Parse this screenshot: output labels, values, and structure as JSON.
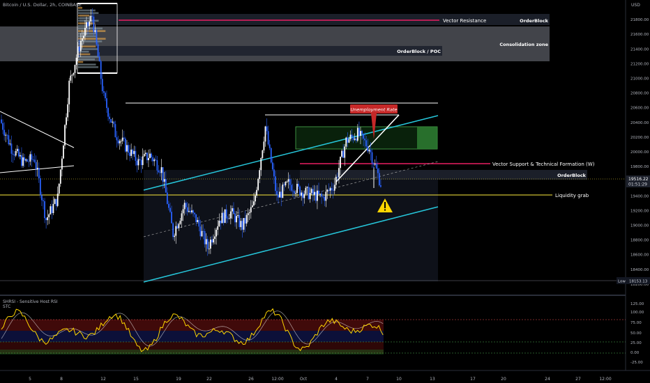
{
  "header": {
    "symbol_title": "Bitcoin / U.S. Dollar, 2h, COINBASE"
  },
  "price_axis": {
    "unit": "USD",
    "ticks": [
      "21800.00",
      "21600.00",
      "21400.00",
      "21200.00",
      "21000.00",
      "20800.00",
      "20600.00",
      "20400.00",
      "20200.00",
      "20000.00",
      "19800.00",
      "19600.00",
      "19400.00",
      "19200.00",
      "19000.00",
      "18800.00",
      "18600.00",
      "18400.00",
      "18200.00"
    ],
    "current_price": "19516.22",
    "countdown": "01:51:29",
    "low_label": "Low",
    "low_value": "18153.13"
  },
  "time_axis": {
    "ticks": [
      "5",
      "8",
      "12",
      "15",
      "19",
      "22",
      "26",
      "12:00",
      "Oct",
      "4",
      "7",
      "10",
      "13",
      "17",
      "20",
      "24",
      "27",
      "12:00"
    ]
  },
  "indicators": {
    "shrsi_title": "SHRSI - Sensitive Host RSI",
    "stc_title": "STC",
    "ticks": [
      "125.00",
      "100.00",
      "75.00",
      "50.00",
      "25.00",
      "0.00",
      "-25.00"
    ]
  },
  "annotations": {
    "vector_resistance": "Vector Resistance",
    "orderblock_top": "OrderBlock",
    "consolidation_zone": "Consolidation zone",
    "orderblock_poc": "OrderBlock / POC",
    "unemployment_rate": "Unemployment Rate",
    "vector_support": "Vector Support & Technical Formation (W)",
    "orderblock_mid": "OrderBlock",
    "liquidity_grab": "Liquidity grab",
    "warning_icon": "warning-triangle-icon"
  },
  "colors": {
    "background": "#000000",
    "candle_up": "#ffffff",
    "candle_down": "#2962ff",
    "channel": "#26c6da",
    "vector_line": "#e91e63",
    "liquidity_line": "#ffeb3b",
    "stc_line": "#ffd600"
  },
  "chart_data": {
    "type": "candlestick",
    "title": "Bitcoin / U.S. Dollar, 2h, COINBASE",
    "ylim": [
      18150,
      21900
    ],
    "series": [
      {
        "name": "BTCUSD",
        "approx_path": [
          {
            "x": "4",
            "y": 20400
          },
          {
            "x": "5",
            "y": 20000
          },
          {
            "x": "6",
            "y": 19800
          },
          {
            "x": "7",
            "y": 19850
          },
          {
            "x": "8",
            "y": 19000
          },
          {
            "x": "9",
            "y": 19300
          },
          {
            "x": "10",
            "y": 20900
          },
          {
            "x": "11",
            "y": 21500
          },
          {
            "x": "12",
            "y": 21850
          },
          {
            "x": "13",
            "y": 20700
          },
          {
            "x": "14",
            "y": 20200
          },
          {
            "x": "15",
            "y": 20000
          },
          {
            "x": "16",
            "y": 19800
          },
          {
            "x": "17",
            "y": 19900
          },
          {
            "x": "18",
            "y": 19700
          },
          {
            "x": "19",
            "y": 18800
          },
          {
            "x": "20",
            "y": 19200
          },
          {
            "x": "21",
            "y": 19000
          },
          {
            "x": "22",
            "y": 18600
          },
          {
            "x": "23",
            "y": 19000
          },
          {
            "x": "24",
            "y": 19100
          },
          {
            "x": "25",
            "y": 18900
          },
          {
            "x": "26",
            "y": 19200
          },
          {
            "x": "27",
            "y": 20300
          },
          {
            "x": "28",
            "y": 19300
          },
          {
            "x": "29",
            "y": 19500
          },
          {
            "x": "30",
            "y": 19400
          },
          {
            "x": "Oct",
            "y": 19350
          },
          {
            "x": "2",
            "y": 19300
          },
          {
            "x": "3",
            "y": 19500
          },
          {
            "x": "4",
            "y": 20100
          },
          {
            "x": "5",
            "y": 20200
          },
          {
            "x": "6",
            "y": 20000
          },
          {
            "x": "7",
            "y": 19500
          }
        ]
      }
    ],
    "levels": [
      {
        "name": "Vector Resistance",
        "value": 21700
      },
      {
        "name": "Consolidation zone",
        "from": 21150,
        "to": 21550
      },
      {
        "name": "Vector Support & Technical Formation (W)",
        "value": 19720
      },
      {
        "name": "Liquidity grab",
        "value": 19320
      },
      {
        "name": "Low",
        "value": 18153.13
      }
    ],
    "legend": "none",
    "grid": false
  }
}
